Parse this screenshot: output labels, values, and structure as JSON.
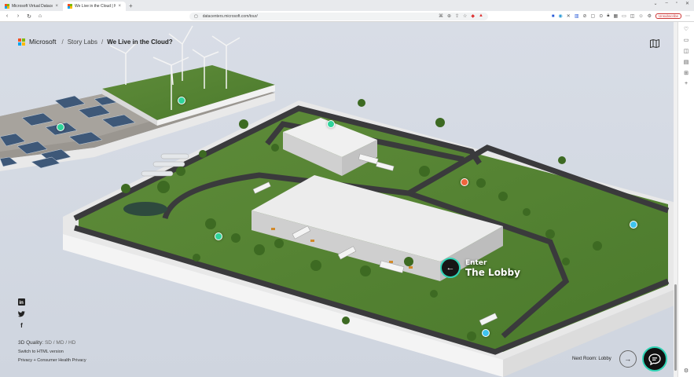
{
  "browser": {
    "tabs": [
      {
        "label": "Microsoft Virtual Datacenter Tour",
        "active": false
      },
      {
        "label": "We Live in the Cloud | Microso",
        "active": true
      }
    ],
    "url": "datacenters.microsoft.com/tour/",
    "extension_badge": "Unsubscribe"
  },
  "header": {
    "brand": "Microsoft",
    "crumb1": "Story Labs",
    "current": "We Live in the Cloud?",
    "separator": "/"
  },
  "icons": {
    "map": "map-icon",
    "linkedin": "in",
    "twitter": "twitter-icon",
    "facebook": "f"
  },
  "footer": {
    "quality_label": "3D Quality:",
    "quality_options": "SD / MD / HD",
    "switch_html": "Switch to HTML version",
    "privacy": "Privacy + Consumer Health Privacy"
  },
  "enter": {
    "line1": "Enter",
    "line2": "The Lobby",
    "arrow": "←"
  },
  "next": {
    "label": "Next Room: Lobby",
    "arrow": "→"
  },
  "hotspots": {
    "green": "#2fd39a",
    "orange": "#f0643c",
    "blue": "#3fc3ee"
  },
  "colors": {
    "accent": "#2fd3b4"
  }
}
